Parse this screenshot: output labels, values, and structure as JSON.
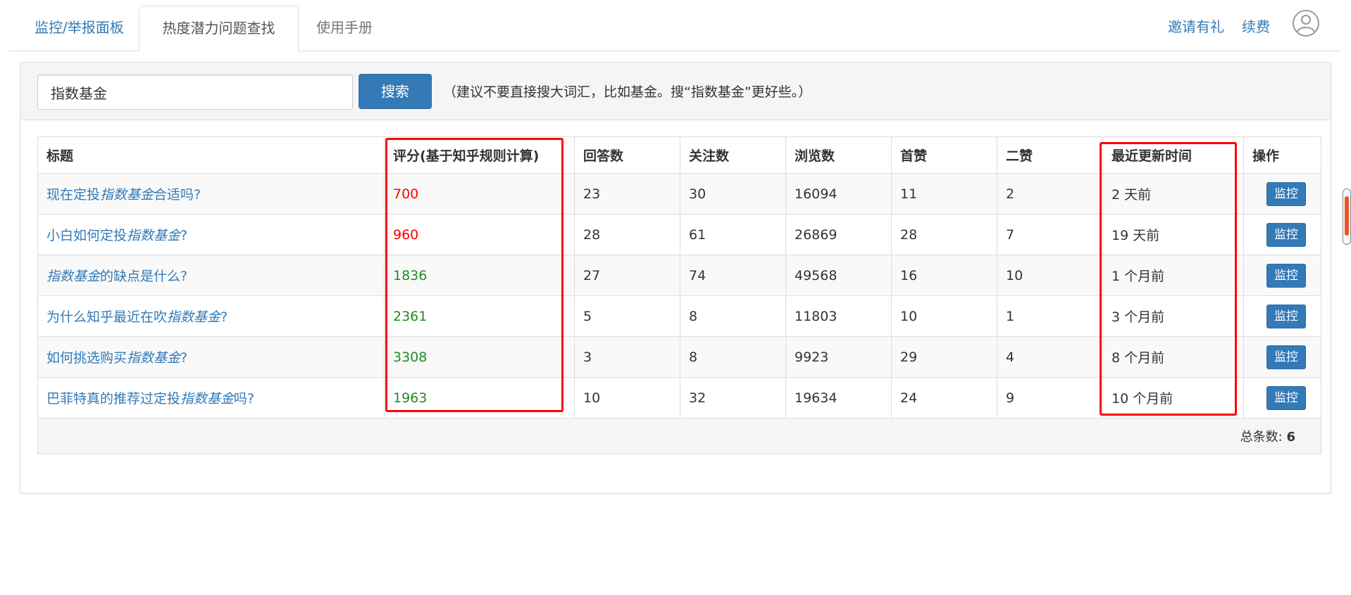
{
  "nav": {
    "tabs": [
      {
        "label": "监控/举报面板"
      },
      {
        "label": "热度潜力问题查找",
        "active": true
      },
      {
        "label": "使用手册"
      }
    ],
    "invite_label": "邀请有礼",
    "renew_label": "续费",
    "avatar_icon": "user-circle-icon"
  },
  "search": {
    "value": "指数基金",
    "button_label": "搜索",
    "hint": "（建议不要直接搜大词汇，比如基金。搜“指数基金”更好些。）"
  },
  "table": {
    "headers": [
      "标题",
      "评分(基于知乎规则计算)",
      "回答数",
      "关注数",
      "浏览数",
      "首赞",
      "二赞",
      "最近更新时间",
      "操作"
    ],
    "rows": [
      {
        "title_pre": "现在定投",
        "title_em": "指数基金",
        "title_post": "合适吗?",
        "score": "700",
        "answers": "23",
        "followers": "30",
        "views": "16094",
        "first_like": "11",
        "second_like": "2",
        "updated": "2 天前",
        "action": "监控"
      },
      {
        "title_pre": "小白如何定投",
        "title_em": "指数基金",
        "title_post": "?",
        "score": "960",
        "answers": "28",
        "followers": "61",
        "views": "26869",
        "first_like": "28",
        "second_like": "7",
        "updated": "19 天前",
        "action": "监控"
      },
      {
        "title_pre": "",
        "title_em": "指数基金",
        "title_post": "的缺点是什么?",
        "score": "1836",
        "answers": "27",
        "followers": "74",
        "views": "49568",
        "first_like": "16",
        "second_like": "10",
        "updated": "1 个月前",
        "action": "监控"
      },
      {
        "title_pre": "为什么知乎最近在吹",
        "title_em": "指数基金",
        "title_post": "?",
        "score": "2361",
        "answers": "5",
        "followers": "8",
        "views": "11803",
        "first_like": "10",
        "second_like": "1",
        "updated": "3 个月前",
        "action": "监控"
      },
      {
        "title_pre": "如何挑选购买",
        "title_em": "指数基金",
        "title_post": "?",
        "score": "3308",
        "answers": "3",
        "followers": "8",
        "views": "9923",
        "first_like": "29",
        "second_like": "4",
        "updated": "8 个月前",
        "action": "监控"
      },
      {
        "title_pre": "巴菲特真的推荐过定投",
        "title_em": "指数基金",
        "title_post": "吗?",
        "score": "1963",
        "answers": "10",
        "followers": "32",
        "views": "19634",
        "first_like": "24",
        "second_like": "9",
        "updated": "10 个月前",
        "action": "监控"
      }
    ],
    "total_label": "总条数: ",
    "total_value": "6"
  },
  "colors": {
    "link": "#337ab7",
    "score_low": "#ff0000",
    "score_high": "#228b22",
    "highlight_box": "#ff0000"
  }
}
